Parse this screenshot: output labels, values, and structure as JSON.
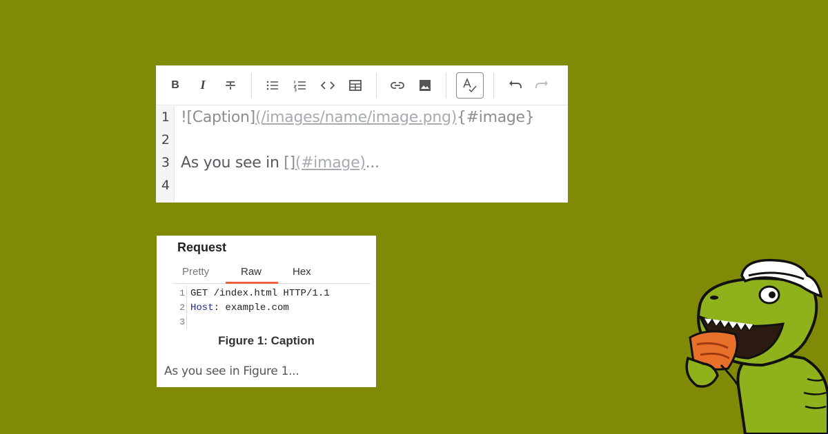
{
  "editor": {
    "toolbar": {
      "bold_label": "B",
      "italic_label": "I",
      "icons": [
        "strikethrough-icon",
        "bullet-list-icon",
        "numbered-list-icon",
        "code-icon",
        "table-icon",
        "link-icon",
        "image-icon",
        "spellcheck-icon",
        "undo-icon",
        "redo-icon"
      ]
    },
    "gutter": [
      "1",
      "2",
      "3",
      "4"
    ],
    "line1": {
      "bang": "![Caption]",
      "url": "(/images/name/image.png)",
      "anchor": "{#image}"
    },
    "line3": {
      "text": "As you see in ",
      "brackets": "[]",
      "ref": "(#image)",
      "ellipsis": "..."
    }
  },
  "preview": {
    "title": "Request",
    "tabs": [
      "Pretty",
      "Raw",
      "Hex"
    ],
    "active_tab": "Raw",
    "code_lines": [
      {
        "num": "1",
        "text": "GET /index.html HTTP/1.1"
      },
      {
        "num": "2",
        "key": "Host",
        "rest": ": example.com"
      },
      {
        "num": "3",
        "text": ""
      }
    ],
    "figure_caption": "Figure 1: Caption",
    "body_text": "As you see in Figure 1..."
  },
  "colors": {
    "background": "#818a06",
    "tab_accent": "#e8613c",
    "mascot_green": "#8fb21c"
  }
}
